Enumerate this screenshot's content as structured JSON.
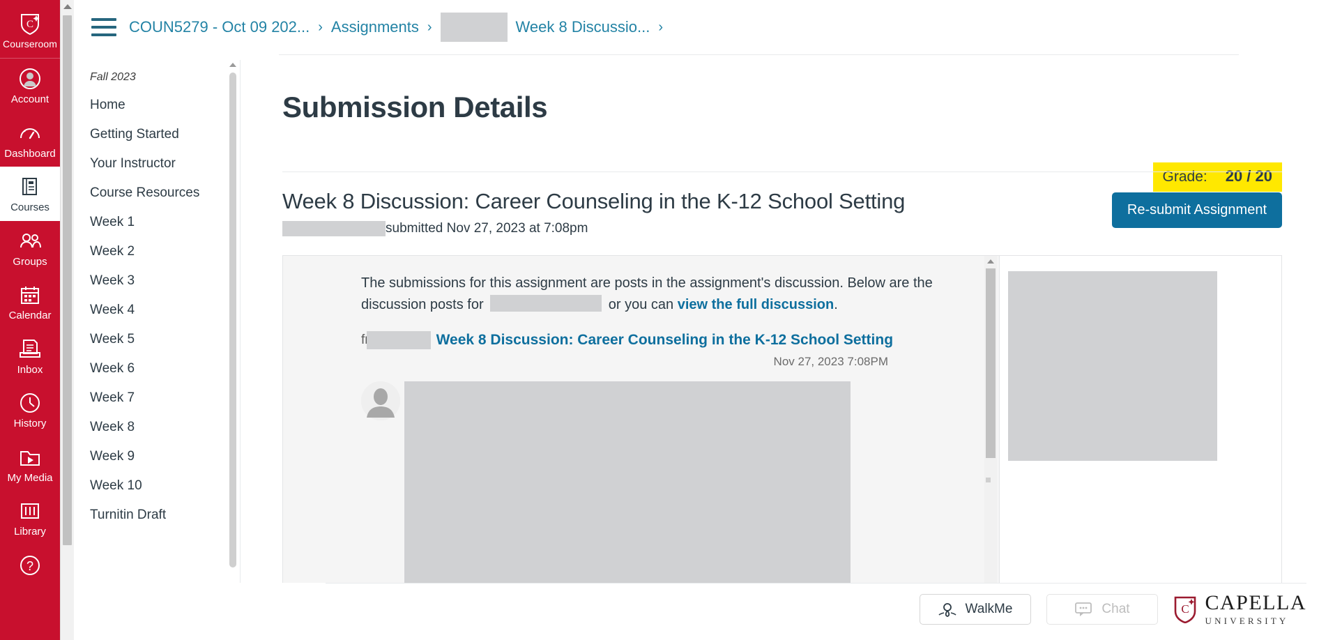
{
  "global_nav": {
    "logo": {
      "label": "Courseroom",
      "icon": "capella-shield-icon"
    },
    "items": [
      {
        "label": "Account",
        "icon": "user-circle-icon",
        "active": false
      },
      {
        "label": "Dashboard",
        "icon": "dashboard-icon",
        "active": false
      },
      {
        "label": "Courses",
        "icon": "book-icon",
        "active": true
      },
      {
        "label": "Groups",
        "icon": "groups-icon",
        "active": false
      },
      {
        "label": "Calendar",
        "icon": "calendar-icon",
        "active": false
      },
      {
        "label": "Inbox",
        "icon": "inbox-icon",
        "active": false
      },
      {
        "label": "History",
        "icon": "clock-icon",
        "active": false
      },
      {
        "label": "My Media",
        "icon": "media-folder-icon",
        "active": false
      },
      {
        "label": "Library",
        "icon": "library-icon",
        "active": false
      }
    ]
  },
  "breadcrumb": {
    "menu_icon": "hamburger-icon",
    "items": [
      {
        "label": "COUN5279 - Oct 09 202...",
        "type": "link"
      },
      {
        "label": "Assignments",
        "type": "link"
      },
      {
        "label": "Week 8 Discussio...",
        "type": "current"
      }
    ],
    "separator": "›",
    "redacted_before_current": true
  },
  "course_nav": {
    "term": "Fall 2023",
    "items": [
      "Home",
      "Getting Started",
      "Your Instructor",
      "Course Resources",
      "Week 1",
      "Week 2",
      "Week 3",
      "Week 4",
      "Week 5",
      "Week 6",
      "Week 7",
      "Week 8",
      "Week 9",
      "Week 10",
      "Turnitin Draft"
    ]
  },
  "main": {
    "page_title": "Submission Details",
    "grade": {
      "label": "Grade:",
      "value": "20 / 20",
      "highlight_color": "#FFE800"
    },
    "assignment": {
      "title": "Week 8 Discussion: Career Counseling in the K-12 School Setting",
      "submitted_text": "submitted Nov 27, 2023 at 7:08pm",
      "resubmit_label": "Re-submit Assignment",
      "resubmit_color": "#0E6F9E"
    },
    "preview": {
      "intro_part1": "The submissions for this assignment are posts in the assignment's discussion. Below are the discussion posts for",
      "intro_part2": "or you can",
      "intro_link": "view the full discussion",
      "intro_end": ".",
      "post": {
        "from_label": "fr",
        "title": "Week 8 Discussion: Career Counseling in the K-12 School Setting",
        "date": "Nov 27, 2023 7:08PM",
        "avatar_icon": "default-avatar-icon"
      }
    }
  },
  "footer": {
    "walkme": {
      "label": "WalkMe",
      "icon": "walkme-pin-icon"
    },
    "chat": {
      "label": "Chat",
      "icon": "chat-bubble-icon",
      "disabled": true
    },
    "brand": {
      "name": "CAPELLA",
      "subtitle": "UNIVERSITY",
      "icon": "capella-shield-icon"
    }
  }
}
